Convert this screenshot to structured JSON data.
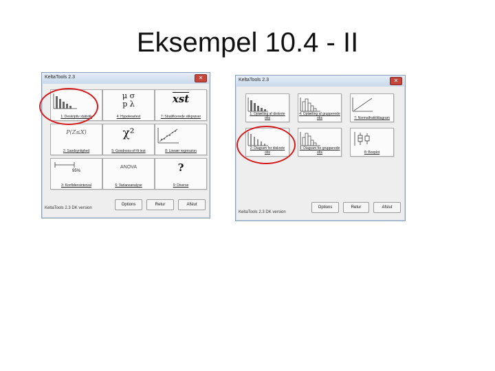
{
  "slide": {
    "title": "Eksempel 10.4 - II"
  },
  "dialog_left": {
    "title": "KeltaTools 2.3",
    "close_glyph": "✕",
    "tiles": [
      {
        "label": "1: Deskriptiv statistik",
        "icon": "histogram-icon"
      },
      {
        "label": "4: Hypotesetest",
        "icon": "mu-sigma-icon",
        "symbols_top": "μ σ",
        "symbols_bottom": "p λ"
      },
      {
        "label": "7: Stratificerede stikprøver",
        "icon": "xst-icon",
        "symbol": "xst"
      },
      {
        "label": "2: Sandsynlighed",
        "icon": "probability-icon",
        "symbol": "P(Z≤X)"
      },
      {
        "label": "5: Goodness-of-fit test",
        "icon": "chi-square-icon",
        "symbol": "χ²"
      },
      {
        "label": "8: Lineær regression",
        "icon": "regression-icon"
      },
      {
        "label": "3: Konfidensinterval",
        "icon": "interval-icon",
        "symbol": "95%"
      },
      {
        "label": "6: Variansanalyse",
        "icon": "anova-icon",
        "symbol": "ANOVA"
      },
      {
        "label": "9: Diverse",
        "icon": "question-icon",
        "symbol": "?"
      }
    ],
    "buttons": {
      "options": "Options",
      "retur": "Retur",
      "afslut": "Afslut"
    },
    "footer": "KeltaTools 2.3 DK version"
  },
  "dialog_right": {
    "title": "KeltaTools 2.3",
    "close_glyph": "✕",
    "tiles": [
      {
        "label": "1: Optælling af diskrete obs",
        "icon": "histogram-icon"
      },
      {
        "label": "4: Optælling af grupperede obs",
        "icon": "grouped-histogram-icon"
      },
      {
        "label": "7: Normalfraktildiagram",
        "icon": "normal-plot-icon"
      },
      {
        "label": "2: Diagram for diskrete obs",
        "icon": "bar-diagram-icon"
      },
      {
        "label": "5: Diagram for grupperede obs",
        "icon": "grouped-bar-icon"
      },
      {
        "label": "8: Boxplot",
        "icon": "boxplot-icon"
      }
    ],
    "buttons": {
      "options": "Options",
      "retur": "Retur",
      "afslut": "Afslut"
    },
    "footer": "KeltaTools 2.3 DK version"
  },
  "highlight_color": "#d41a1a"
}
